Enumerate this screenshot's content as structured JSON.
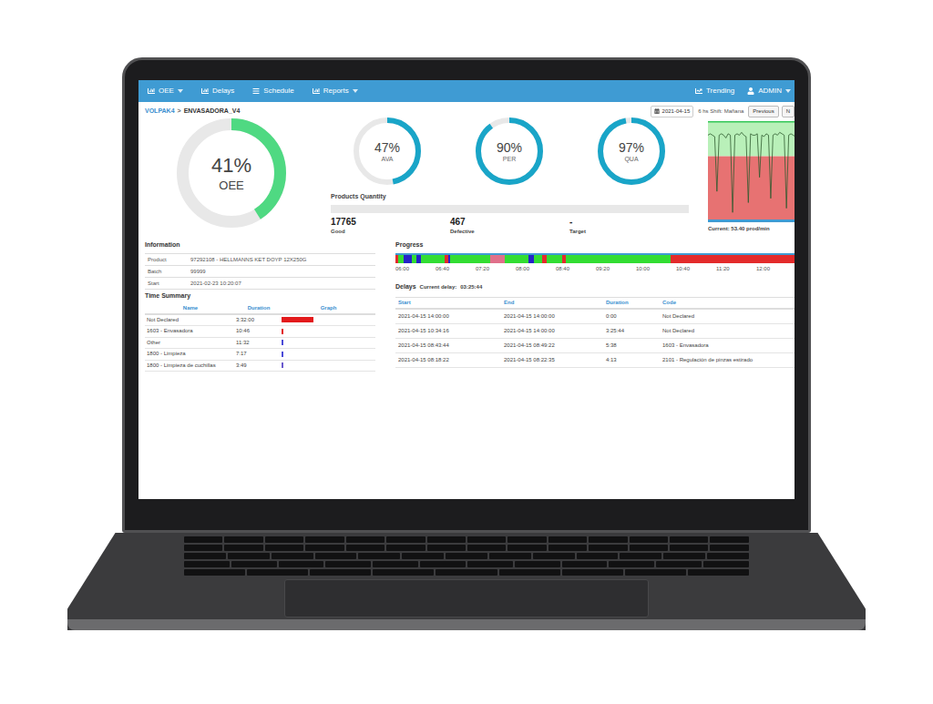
{
  "nav": {
    "left": [
      {
        "label": "OEE",
        "dropdown": true
      },
      {
        "label": "Delays",
        "dropdown": false
      },
      {
        "label": "Schedule",
        "dropdown": false
      },
      {
        "label": "Reports",
        "dropdown": true
      }
    ],
    "right": [
      {
        "label": "Trending",
        "dropdown": false
      },
      {
        "label": "ADMIN",
        "dropdown": true
      }
    ]
  },
  "breadcrumb": {
    "plant": "VOLPAK4",
    "separator": ">",
    "machine": "ENVASADORA_V4"
  },
  "shift_bar": {
    "date": "2021-04-15",
    "shift": "6 hs Shift: Mañana",
    "buttons": [
      "Previous",
      "N"
    ]
  },
  "oee": {
    "value": "41%",
    "label": "OEE",
    "level": 0.41
  },
  "gauges": [
    {
      "value": "47%",
      "label": "AVA",
      "level": 0.47
    },
    {
      "value": "90%",
      "label": "PER",
      "level": 0.9
    },
    {
      "value": "97%",
      "label": "QUA",
      "level": 0.97
    }
  ],
  "products": {
    "title": "Products Quantity",
    "level": 0,
    "counts": [
      {
        "value": "17765",
        "label": "Good"
      },
      {
        "value": "467",
        "label": "Defective"
      },
      {
        "value": "-",
        "label": "Target"
      }
    ]
  },
  "rate_chart": {
    "max": 70,
    "threshold": 45,
    "values": [
      60,
      61,
      60,
      59,
      20,
      60,
      61,
      60,
      58,
      61,
      60,
      5,
      60,
      61,
      60,
      62,
      60,
      59,
      12,
      61,
      60,
      60,
      61,
      30,
      60,
      59,
      61,
      60,
      15,
      60,
      61,
      60,
      62,
      61,
      60,
      8,
      60,
      61,
      60,
      59
    ],
    "current": "Current: 53.40 prod/min"
  },
  "information": {
    "title": "Information",
    "rows": [
      {
        "label": "Product",
        "value": "97292108 - HELLMANNS KET DOYP 12X250G"
      },
      {
        "label": "Batch",
        "value": "99999"
      },
      {
        "label": "Start",
        "value": "2021-02-23 10:20:07"
      }
    ]
  },
  "time_summary": {
    "title": "Time Summary",
    "columns": [
      "Name",
      "Duration",
      "Graph"
    ],
    "rows": [
      {
        "name": "Not Declared",
        "duration": "3:32:00",
        "level": 0.34,
        "color": "#e31a1c"
      },
      {
        "name": "1603 - Envasadora",
        "duration": "10:46",
        "level": 0.02,
        "color": "#e31a1c"
      },
      {
        "name": "Other",
        "duration": "11:32",
        "level": 0.02,
        "color": "#4b4bd8"
      },
      {
        "name": "1800 - Limpieza",
        "duration": "7:17",
        "level": 0.015,
        "color": "#4b4bd8"
      },
      {
        "name": "1800 - Limpieza de cuchillas",
        "duration": "3:49",
        "level": 0.012,
        "color": "#6a5acd"
      }
    ]
  },
  "progress": {
    "title": "Progress",
    "segments": [
      {
        "color": "#e32b2b",
        "share": 0.006
      },
      {
        "color": "#33dd33",
        "share": 0.014
      },
      {
        "color": "#2424c8",
        "share": 0.02
      },
      {
        "color": "#33dd33",
        "share": 0.012
      },
      {
        "color": "#2424c8",
        "share": 0.012
      },
      {
        "color": "#33dd33",
        "share": 0.06
      },
      {
        "color": "#e32b2b",
        "share": 0.008
      },
      {
        "color": "#2424c8",
        "share": 0.006
      },
      {
        "color": "#33dd33",
        "share": 0.1
      },
      {
        "color": "#e0708a",
        "share": 0.035
      },
      {
        "color": "#33dd33",
        "share": 0.06
      },
      {
        "color": "#2424c8",
        "share": 0.014
      },
      {
        "color": "#33dd33",
        "share": 0.02
      },
      {
        "color": "#e32b2b",
        "share": 0.012
      },
      {
        "color": "#33dd33",
        "share": 0.04
      },
      {
        "color": "#e32b2b",
        "share": 0.008
      },
      {
        "color": "#33dd33",
        "share": 0.263
      },
      {
        "color": "#e32b2b",
        "share": 0.31
      }
    ],
    "ticks": [
      "06:00",
      "06:40",
      "07:20",
      "08:00",
      "08:40",
      "09:20",
      "10:00",
      "10:40",
      "11:20",
      "12:00"
    ]
  },
  "delays": {
    "title": "Delays",
    "current_label": "Current delay:",
    "current_value": "03:25:44",
    "columns": [
      "Start",
      "End",
      "Duration",
      "Code"
    ],
    "rows": [
      [
        "2021-04-15 14:00:00",
        "2021-04-15 14:00:00",
        "0:00",
        "Not Declared"
      ],
      [
        "2021-04-15 10:34:16",
        "2021-04-15 14:00:00",
        "3:25:44",
        "Not Declared"
      ],
      [
        "2021-04-15 08:43:44",
        "2021-04-15 08:49:22",
        "5:38",
        "1603 - Envasadora"
      ],
      [
        "2021-04-15 08:18:22",
        "2021-04-15 08:22:35",
        "4:13",
        "2101 - Regulación de pinzas estirado"
      ]
    ]
  }
}
